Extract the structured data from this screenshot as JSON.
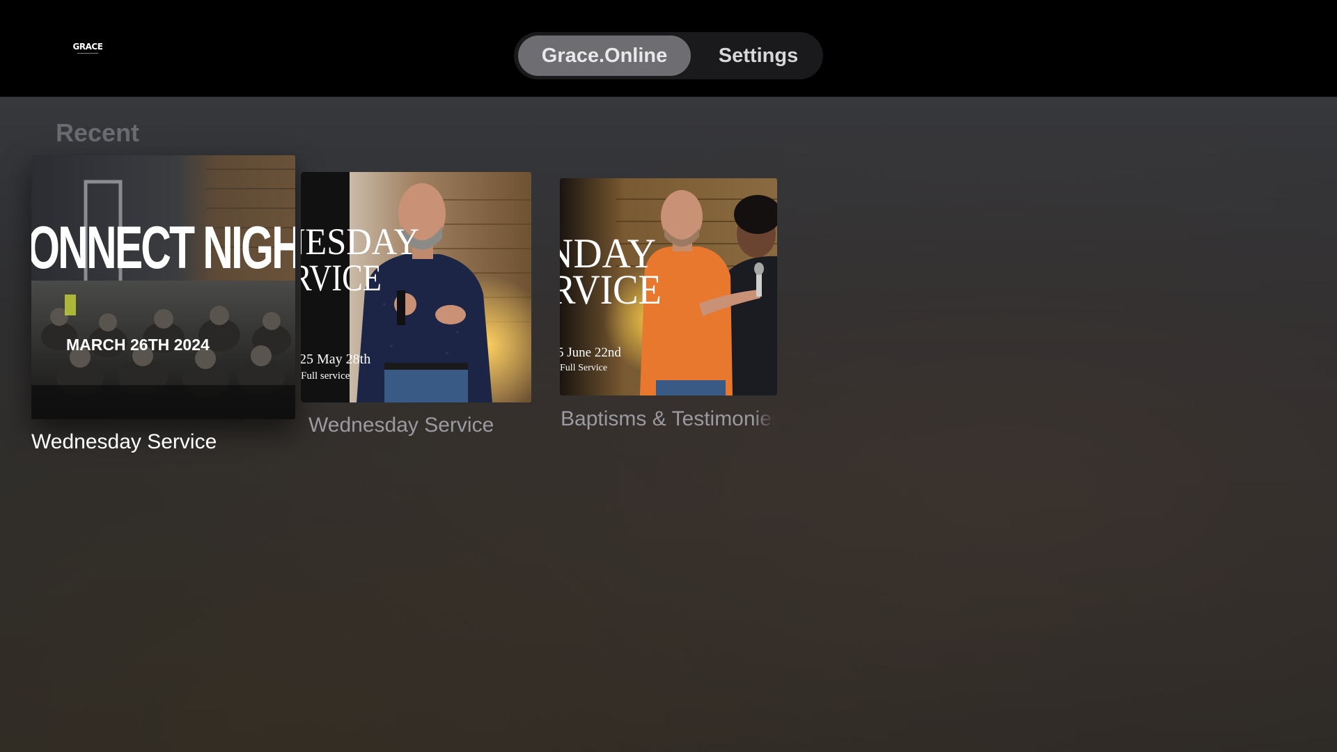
{
  "app": {
    "logo_text": "GRACE"
  },
  "nav": {
    "tabs": [
      {
        "label": "Grace.Online",
        "active": true
      },
      {
        "label": "Settings",
        "active": false
      }
    ]
  },
  "recent": {
    "title": "Recent",
    "items": [
      {
        "label": "Wednesday Service",
        "focused": true,
        "thumbnail_text": [
          "ONNECT NIGH",
          "MARCH 26TH 2024"
        ]
      },
      {
        "label": "Wednesday Service",
        "focused": false,
        "thumbnail_text": [
          "NESDAY",
          "RVICE",
          "25 May 28th",
          "Full service"
        ]
      },
      {
        "label": "Baptisms & Testimonies",
        "focused": false,
        "thumbnail_text": [
          "NDAY",
          "RVICE",
          "5 June 22nd",
          "Full Service"
        ]
      }
    ]
  },
  "colors": {
    "active_tab": "#6e6e72",
    "focused_label": "#ffffff",
    "unfocused_label": "#9a9aa0",
    "section_title": "#6a6b70"
  }
}
